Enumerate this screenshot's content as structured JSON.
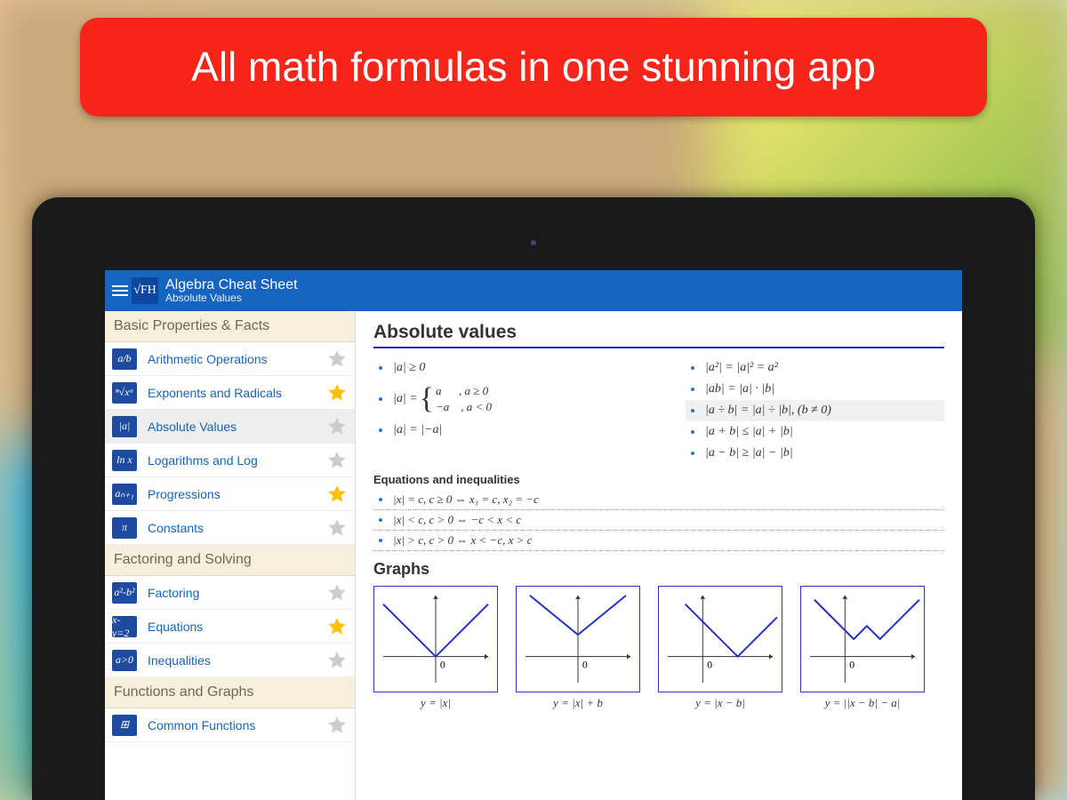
{
  "banner": {
    "text": "All math formulas in one stunning app"
  },
  "header": {
    "logo": "√FH",
    "title": "Algebra Cheat Sheet",
    "subtitle": "Absolute Values"
  },
  "sidebar": {
    "sections": [
      {
        "title": "Basic Properties & Facts",
        "items": [
          {
            "icon": "a/b",
            "label": "Arithmetic Operations",
            "starred": false,
            "active": false
          },
          {
            "icon": "ⁿ√xᵃ",
            "label": "Exponents and Radicals",
            "starred": true,
            "active": false
          },
          {
            "icon": "|a|",
            "label": "Absolute Values",
            "starred": false,
            "active": true
          },
          {
            "icon": "ln x",
            "label": "Logarithms and Log",
            "starred": false,
            "active": false
          },
          {
            "icon": "aₙ₊₁",
            "label": "Progressions",
            "starred": true,
            "active": false
          },
          {
            "icon": "π",
            "label": "Constants",
            "starred": false,
            "active": false
          }
        ]
      },
      {
        "title": "Factoring and Solving",
        "items": [
          {
            "icon": "a²-b²",
            "label": "Factoring",
            "starred": false,
            "active": false
          },
          {
            "icon": "x-y=2",
            "label": "Equations",
            "starred": true,
            "active": false
          },
          {
            "icon": "a>0",
            "label": "Inequalities",
            "starred": false,
            "active": false
          }
        ]
      },
      {
        "title": "Functions and Graphs",
        "items": [
          {
            "icon": "⊞",
            "label": "Common Functions",
            "starred": false,
            "active": false
          }
        ]
      }
    ]
  },
  "content": {
    "title": "Absolute values",
    "col1": [
      "|a| ≥ 0",
      "|a| = |−a|"
    ],
    "piecewise": {
      "lhs": "|a| = ",
      "case1": "a      , a ≥ 0",
      "case2": "−a    , a < 0"
    },
    "col2": [
      {
        "text": "|a²| = |a|² = a²",
        "hl": false
      },
      {
        "text": "|ab| = |a| · |b|",
        "hl": false
      },
      {
        "text": "|a ÷ b| = |a| ÷ |b|,  (b ≠ 0)",
        "hl": true
      },
      {
        "text": "|a + b| ≤ |a| + |b|",
        "hl": false
      },
      {
        "text": "|a − b| ≥ |a| − |b|",
        "hl": false
      }
    ],
    "eq_title": "Equations and inequalities",
    "equations": [
      "|x| = c, c ≥ 0 ⇔ x₁ = c, x₂ = −c",
      "|x| < c, c > 0 ⇔ −c < x < c",
      "|x| > c, c > 0 ⇔ x < −c, x > c"
    ],
    "graphs_title": "Graphs",
    "graphs": [
      {
        "caption": "y = |x|"
      },
      {
        "caption": "y = |x| + b"
      },
      {
        "caption": "y = |x − b|"
      },
      {
        "caption": "y = ||x − b| − a|"
      }
    ]
  }
}
